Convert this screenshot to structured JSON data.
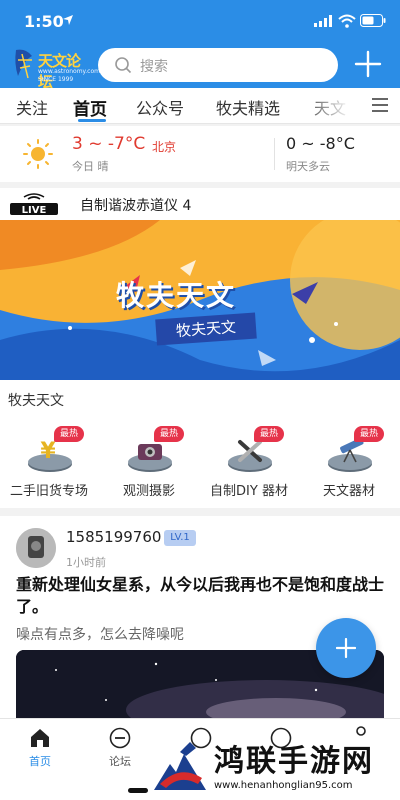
{
  "status_bar": {
    "time": "1:50"
  },
  "header": {
    "logo": {
      "name": "天文论坛",
      "url": "www.astronomy.com.cn",
      "since": "SINCE 1999"
    },
    "search_placeholder": "搜索",
    "accent": "#2b8de6"
  },
  "tabs": [
    {
      "label": "关注",
      "active": false
    },
    {
      "label": "首页",
      "active": true
    },
    {
      "label": "公众号",
      "active": false
    },
    {
      "label": "牧夫精选",
      "active": false
    },
    {
      "label": "天文",
      "active": false
    }
  ],
  "weather": {
    "today_temp": "3 ~ -7°C",
    "city": "北京",
    "today_desc": "今日 晴",
    "tomorrow_temp": "0 ~ -8°C",
    "tomorrow_desc": "明天多云"
  },
  "live": {
    "badge": "LIVE",
    "title": "自制谐波赤道仪 4"
  },
  "banner": {
    "title": "牧夫天文",
    "subtitle": "牧夫天文"
  },
  "section": {
    "name": "牧夫天文",
    "hot_label": "最热",
    "categories": [
      {
        "label": "二手旧货专场",
        "icon": "yen-coin-icon"
      },
      {
        "label": "观测摄影",
        "icon": "camera-icon"
      },
      {
        "label": "自制DIY 器材",
        "icon": "tools-icon"
      },
      {
        "label": "天文器材",
        "icon": "telescope-icon"
      }
    ]
  },
  "post": {
    "username": "1585199760",
    "level": "LV.1",
    "time": "1小时前",
    "title": "重新处理仙女星系，从今以后我再也不是饱和度战士了。",
    "desc": "噪点有点多，怎么去降噪呢"
  },
  "bottom_nav": [
    {
      "label": "首页",
      "icon": "home-icon",
      "active": true
    },
    {
      "label": "论坛",
      "icon": "forum-icon",
      "active": false
    }
  ],
  "watermark": {
    "text": "鸿联手游网",
    "url": "www.henanhonglian95.com"
  }
}
